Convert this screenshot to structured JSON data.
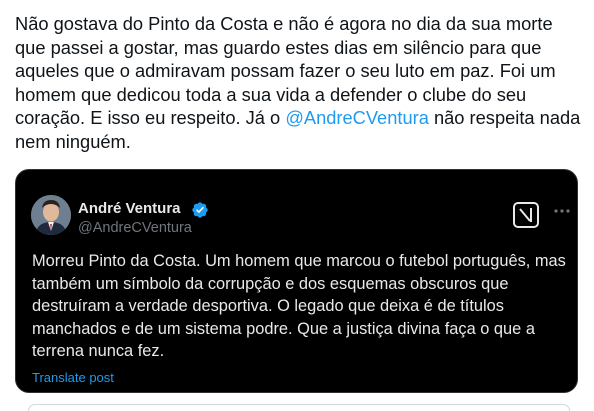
{
  "tweet": {
    "text_before": "Não gostava do Pinto da Costa e não é agora no dia da sua morte que passei a gostar, mas guardo estes dias em silêncio para que aqueles que o admiravam possam fazer o seu luto em paz. Foi um homem que dedicou toda a sua vida a defender o clube do seu coração. E isso eu respeito. Já o ",
    "mention": "@AndreCVentura",
    "text_after": " não respeita nada nem ninguém."
  },
  "quote": {
    "display_name": "André Ventura",
    "handle": "@AndreCVentura",
    "text": "Morreu Pinto da Costa. Um homem que marcou o futebol português, mas também um símbolo da corrupção e dos esquemas obscuros que destruíram a verdade desportiva. O legado que deixa é de títulos manchados e de um sistema podre. Que a justiça divina faça o que a terrena nunca fez.",
    "translate_label": "Translate post",
    "icons": [
      "verified-badge-icon",
      "grok-icon",
      "more-icon"
    ]
  },
  "colors": {
    "link": "#1d9bf0",
    "card_bg": "#000000",
    "card_text": "#e7e9ea",
    "secondary_text": "#71767b",
    "body_text": "#0f1419"
  }
}
